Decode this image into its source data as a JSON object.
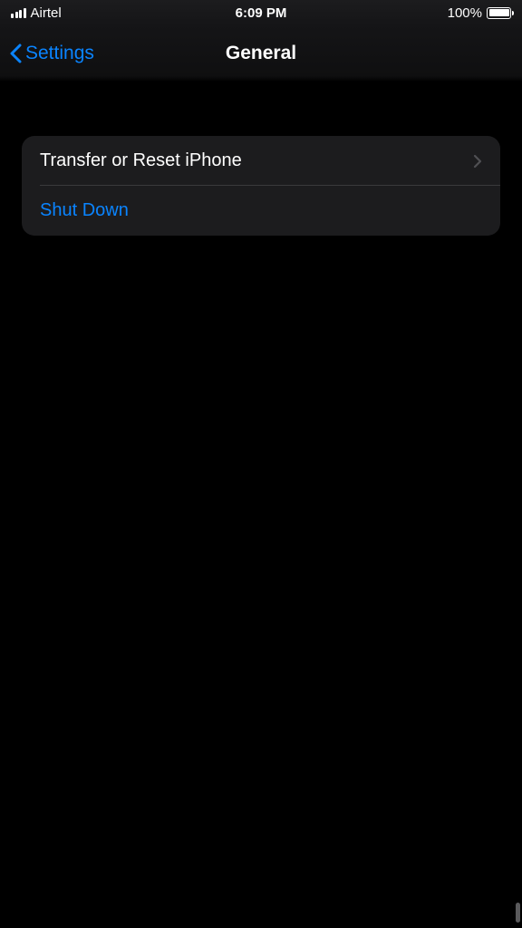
{
  "status_bar": {
    "carrier": "Airtel",
    "time": "6:09 PM",
    "battery_pct": "100%"
  },
  "nav": {
    "back_label": "Settings",
    "title": "General"
  },
  "rows": {
    "transfer_reset": "Transfer or Reset iPhone",
    "shut_down": "Shut Down"
  }
}
